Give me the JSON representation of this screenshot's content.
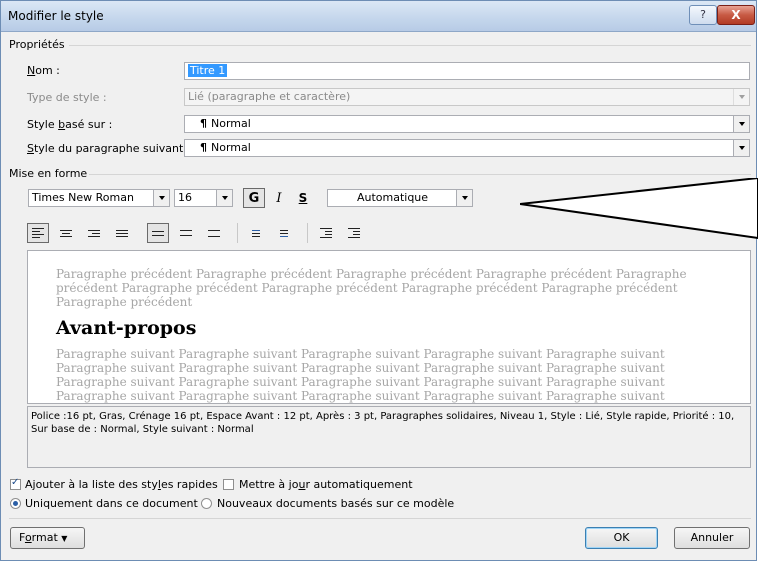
{
  "window": {
    "title": "Modifier le style",
    "help_label": "?",
    "close_label": "X"
  },
  "proprietes": {
    "section_label": "Propriétés",
    "nom": {
      "label": "Nom :",
      "value": "Titre 1"
    },
    "type": {
      "label": "Type de style :",
      "value": "Lié (paragraphe et caractère)"
    },
    "base": {
      "label": "Style basé sur :",
      "value": "Normal"
    },
    "suivant": {
      "label": "Style du paragraphe suivant :",
      "value": "Normal"
    }
  },
  "mise_en_forme": {
    "section_label": "Mise en forme",
    "font": "Times New Roman",
    "size": "16",
    "bold_label": "G",
    "italic_label": "I",
    "underline_label": "S",
    "color": "Automatique"
  },
  "preview": {
    "preceding": "Paragraphe précédent Paragraphe précédent Paragraphe précédent Paragraphe précédent Paragraphe précédent Paragraphe précédent Paragraphe précédent Paragraphe précédent Paragraphe précédent Paragraphe précédent",
    "heading": "Avant-propos",
    "following": "Paragraphe suivant Paragraphe suivant Paragraphe suivant Paragraphe suivant Paragraphe suivant Paragraphe suivant Paragraphe suivant Paragraphe suivant Paragraphe suivant Paragraphe suivant Paragraphe suivant Paragraphe suivant Paragraphe suivant Paragraphe suivant Paragraphe suivant Paragraphe suivant Paragraphe suivant Paragraphe suivant Paragraphe suivant Paragraphe suivant Paragraphe suivant Paragraphe suivant Paragraphe suivant Paragraphe suivant Paragraphe suivant"
  },
  "description": "Police :16 pt, Gras, Crénage 16 pt, Espace Avant : 12 pt, Après : 3 pt, Paragraphes solidaires, Niveau 1, Style : Lié, Style rapide, Priorité : 10, Sur base de : Normal, Style suivant : Normal",
  "options": {
    "add_quick": {
      "label": "Ajouter à la liste des styles rapides",
      "checked": true
    },
    "auto_update": {
      "label": "Mettre à jour automatiquement",
      "checked": false
    },
    "only_doc": {
      "label": "Uniquement dans ce document",
      "selected": true
    },
    "new_docs": {
      "label": "Nouveaux documents basés sur ce modèle",
      "selected": false
    }
  },
  "buttons": {
    "format": "Format",
    "ok": "OK",
    "cancel": "Annuler"
  },
  "colors": {
    "accent": "#3399ff",
    "title_bar": "#c4d6ec",
    "close": "#c75a44"
  }
}
